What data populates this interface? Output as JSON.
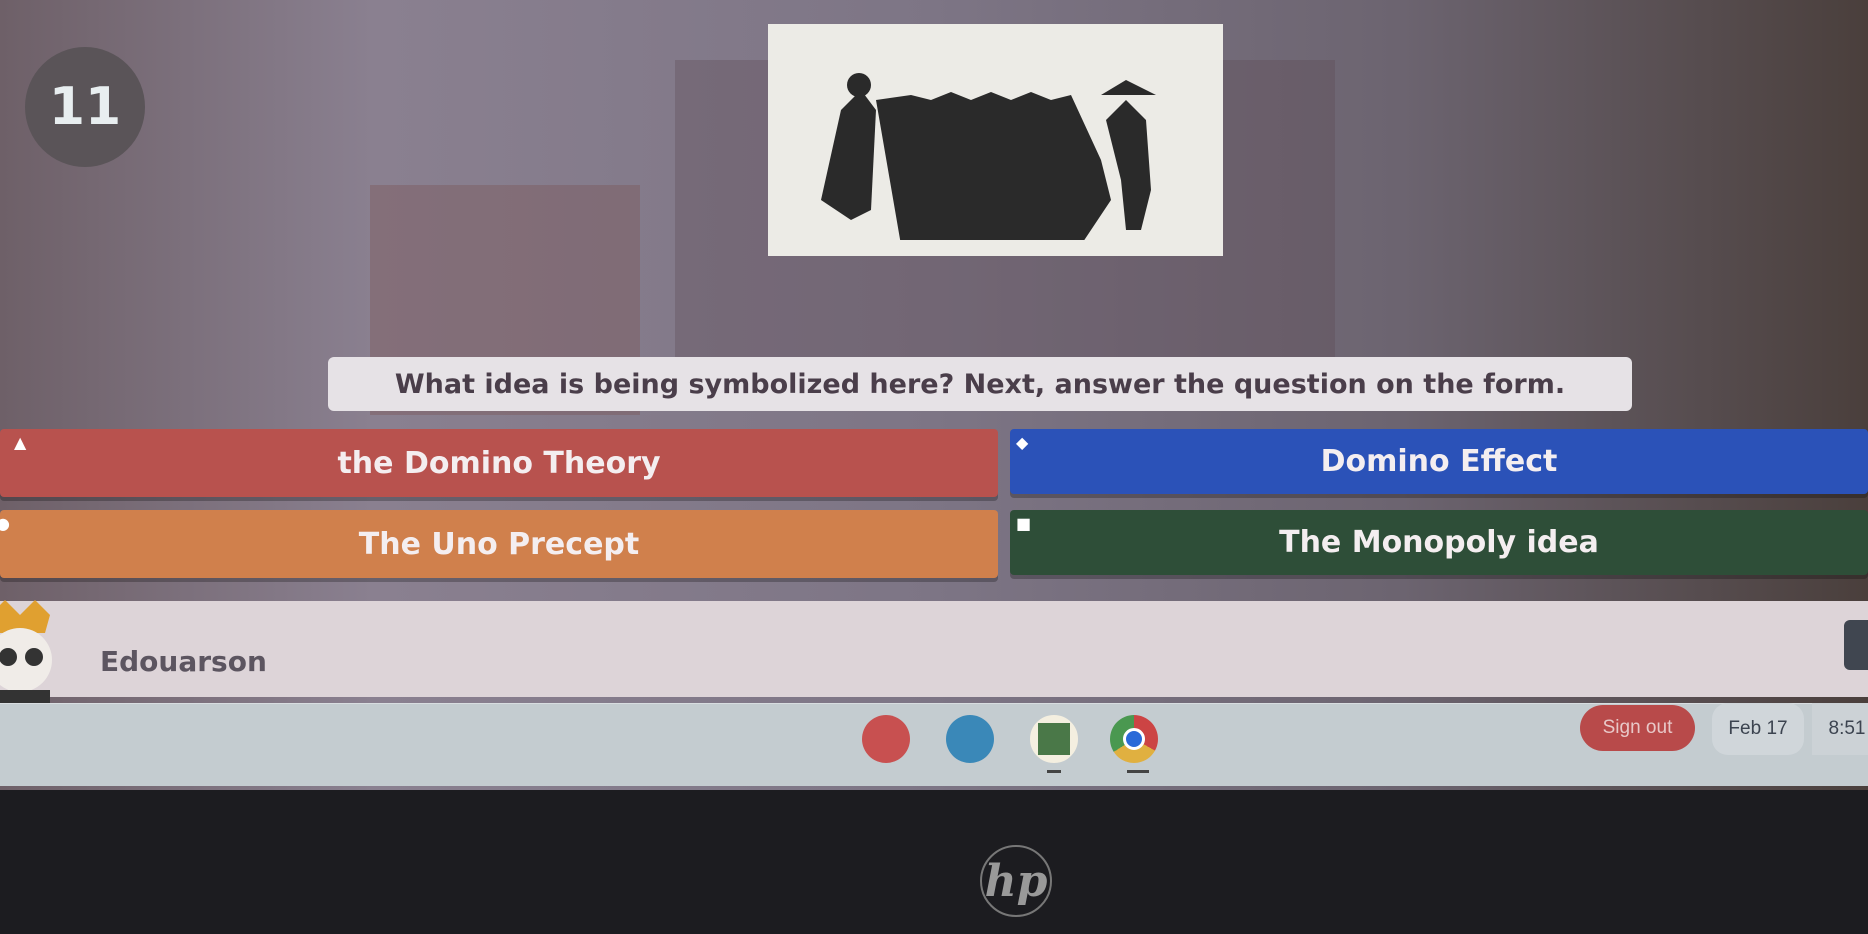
{
  "question": {
    "number": "11",
    "text": "What idea is being symbolized here? Next, answer the question on the form."
  },
  "answers": [
    {
      "label": "the Domino Theory",
      "symbol": "▲",
      "color": "#b8524e"
    },
    {
      "label": "Domino Effect",
      "symbol": "◆",
      "color": "#2b52b8"
    },
    {
      "label": "The Uno Precept",
      "symbol": "●",
      "color": "#d0804c"
    },
    {
      "label": "The Monopoly idea",
      "symbol": "■",
      "color": "#2e4e38"
    }
  ],
  "player": {
    "name": "Edouarson"
  },
  "taskbar": {
    "apps": [
      "palette-icon",
      "slides-icon",
      "classroom-icon",
      "chrome-icon"
    ],
    "sign_out": "Sign out",
    "date": "Feb 17",
    "time": "8:51"
  },
  "bezel": {
    "logo": "hp"
  }
}
